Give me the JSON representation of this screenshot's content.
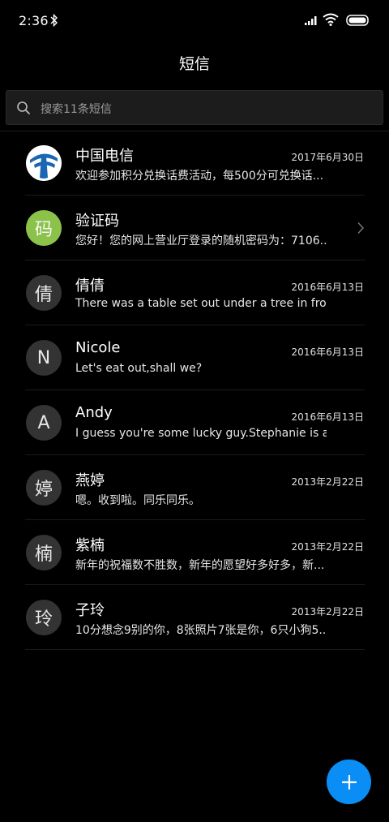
{
  "status_bar": {
    "time": "2:36",
    "icons": [
      "bluetooth-icon",
      "signal-icon",
      "wifi-icon",
      "battery-icon"
    ]
  },
  "header": {
    "title": "短信"
  },
  "search": {
    "placeholder": "搜索11条短信"
  },
  "colors": {
    "background": "#000000",
    "accent": "#0a8ef5",
    "avatar_default": "#333333",
    "avatar_green": "#8bc34a",
    "telecom_blue": "#1a66b3"
  },
  "messages": [
    {
      "name": "中国电信",
      "date": "2017年6月30日",
      "preview": "欢迎参加积分兑换话费活动，每500分可兑换话...",
      "avatar": "",
      "avatar_type": "telecom-logo"
    },
    {
      "name": "验证码",
      "date": "",
      "preview": "您好！您的网上营业厅登录的随机密码为：7106...",
      "avatar": "码",
      "avatar_type": "green",
      "has_chevron": true
    },
    {
      "name": "倩倩",
      "date": "2016年6月13日",
      "preview": "There was a table set out under a tree in fron...",
      "avatar": "倩",
      "avatar_type": "default"
    },
    {
      "name": "Nicole",
      "date": "2016年6月13日",
      "preview": "Let's eat out,shall we?",
      "avatar": "N",
      "avatar_type": "default"
    },
    {
      "name": "Andy",
      "date": "2016年6月13日",
      "preview": "I guess you're some lucky guy.Stephanie is a...",
      "avatar": "A",
      "avatar_type": "default"
    },
    {
      "name": "燕婷",
      "date": "2013年2月22日",
      "preview": "嗯。收到啦。同乐同乐。",
      "avatar": "婷",
      "avatar_type": "default"
    },
    {
      "name": "紫楠",
      "date": "2013年2月22日",
      "preview": "新年的祝福数不胜数，新年的愿望好多好多，新...",
      "avatar": "楠",
      "avatar_type": "default"
    },
    {
      "name": "子玲",
      "date": "2013年2月22日",
      "preview": "10分想念9别的你，8张照片7张是你，6只小狗5...",
      "avatar": "玲",
      "avatar_type": "default"
    }
  ],
  "fab": {
    "icon": "plus-icon"
  }
}
